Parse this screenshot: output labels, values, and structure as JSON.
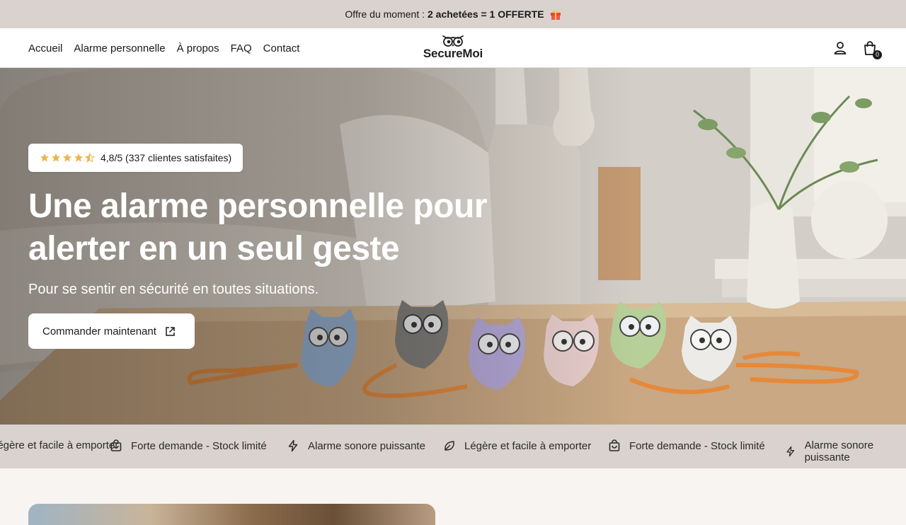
{
  "announcement": {
    "prefix": "Offre du moment :",
    "offer": "2 achetées = 1 OFFERTE",
    "gift_icon": "gift-icon"
  },
  "header": {
    "nav": [
      {
        "label": "Accueil"
      },
      {
        "label": "Alarme personnelle"
      },
      {
        "label": "À propos"
      },
      {
        "label": "FAQ"
      },
      {
        "label": "Contact"
      }
    ],
    "logo_text": "SecureMoi",
    "account_icon": "user-icon",
    "cart_icon": "shopping-bag-icon",
    "cart_count": "0"
  },
  "hero": {
    "rating_stars": 4.5,
    "rating_text": "4,8/5 (337 clientes satisfaites)",
    "title": "Une alarme personnelle pour alerter en un seul geste",
    "subtitle": "Pour se sentir en sécurité en toutes situations.",
    "cta_label": "Commander maintenant",
    "cta_icon": "external-link-icon"
  },
  "marquee": {
    "items": [
      {
        "icon": "leaf-icon",
        "label": "Légère et facile à emporter"
      },
      {
        "icon": "shopping-bag-icon",
        "label": "Forte demande - Stock limité"
      },
      {
        "icon": "lightning-icon",
        "label": "Alarme sonore puissante"
      },
      {
        "icon": "leaf-icon",
        "label": "Légère et facile à emporter"
      },
      {
        "icon": "shopping-bag-icon",
        "label": "Forte demande - Stock limité"
      },
      {
        "icon": "lightning-icon",
        "label": "Alarme sonore puissante"
      }
    ]
  },
  "colors": {
    "announcement_bg": "#d9d2ce",
    "star": "#e8b84a",
    "page_bg": "#f8f4f1"
  }
}
